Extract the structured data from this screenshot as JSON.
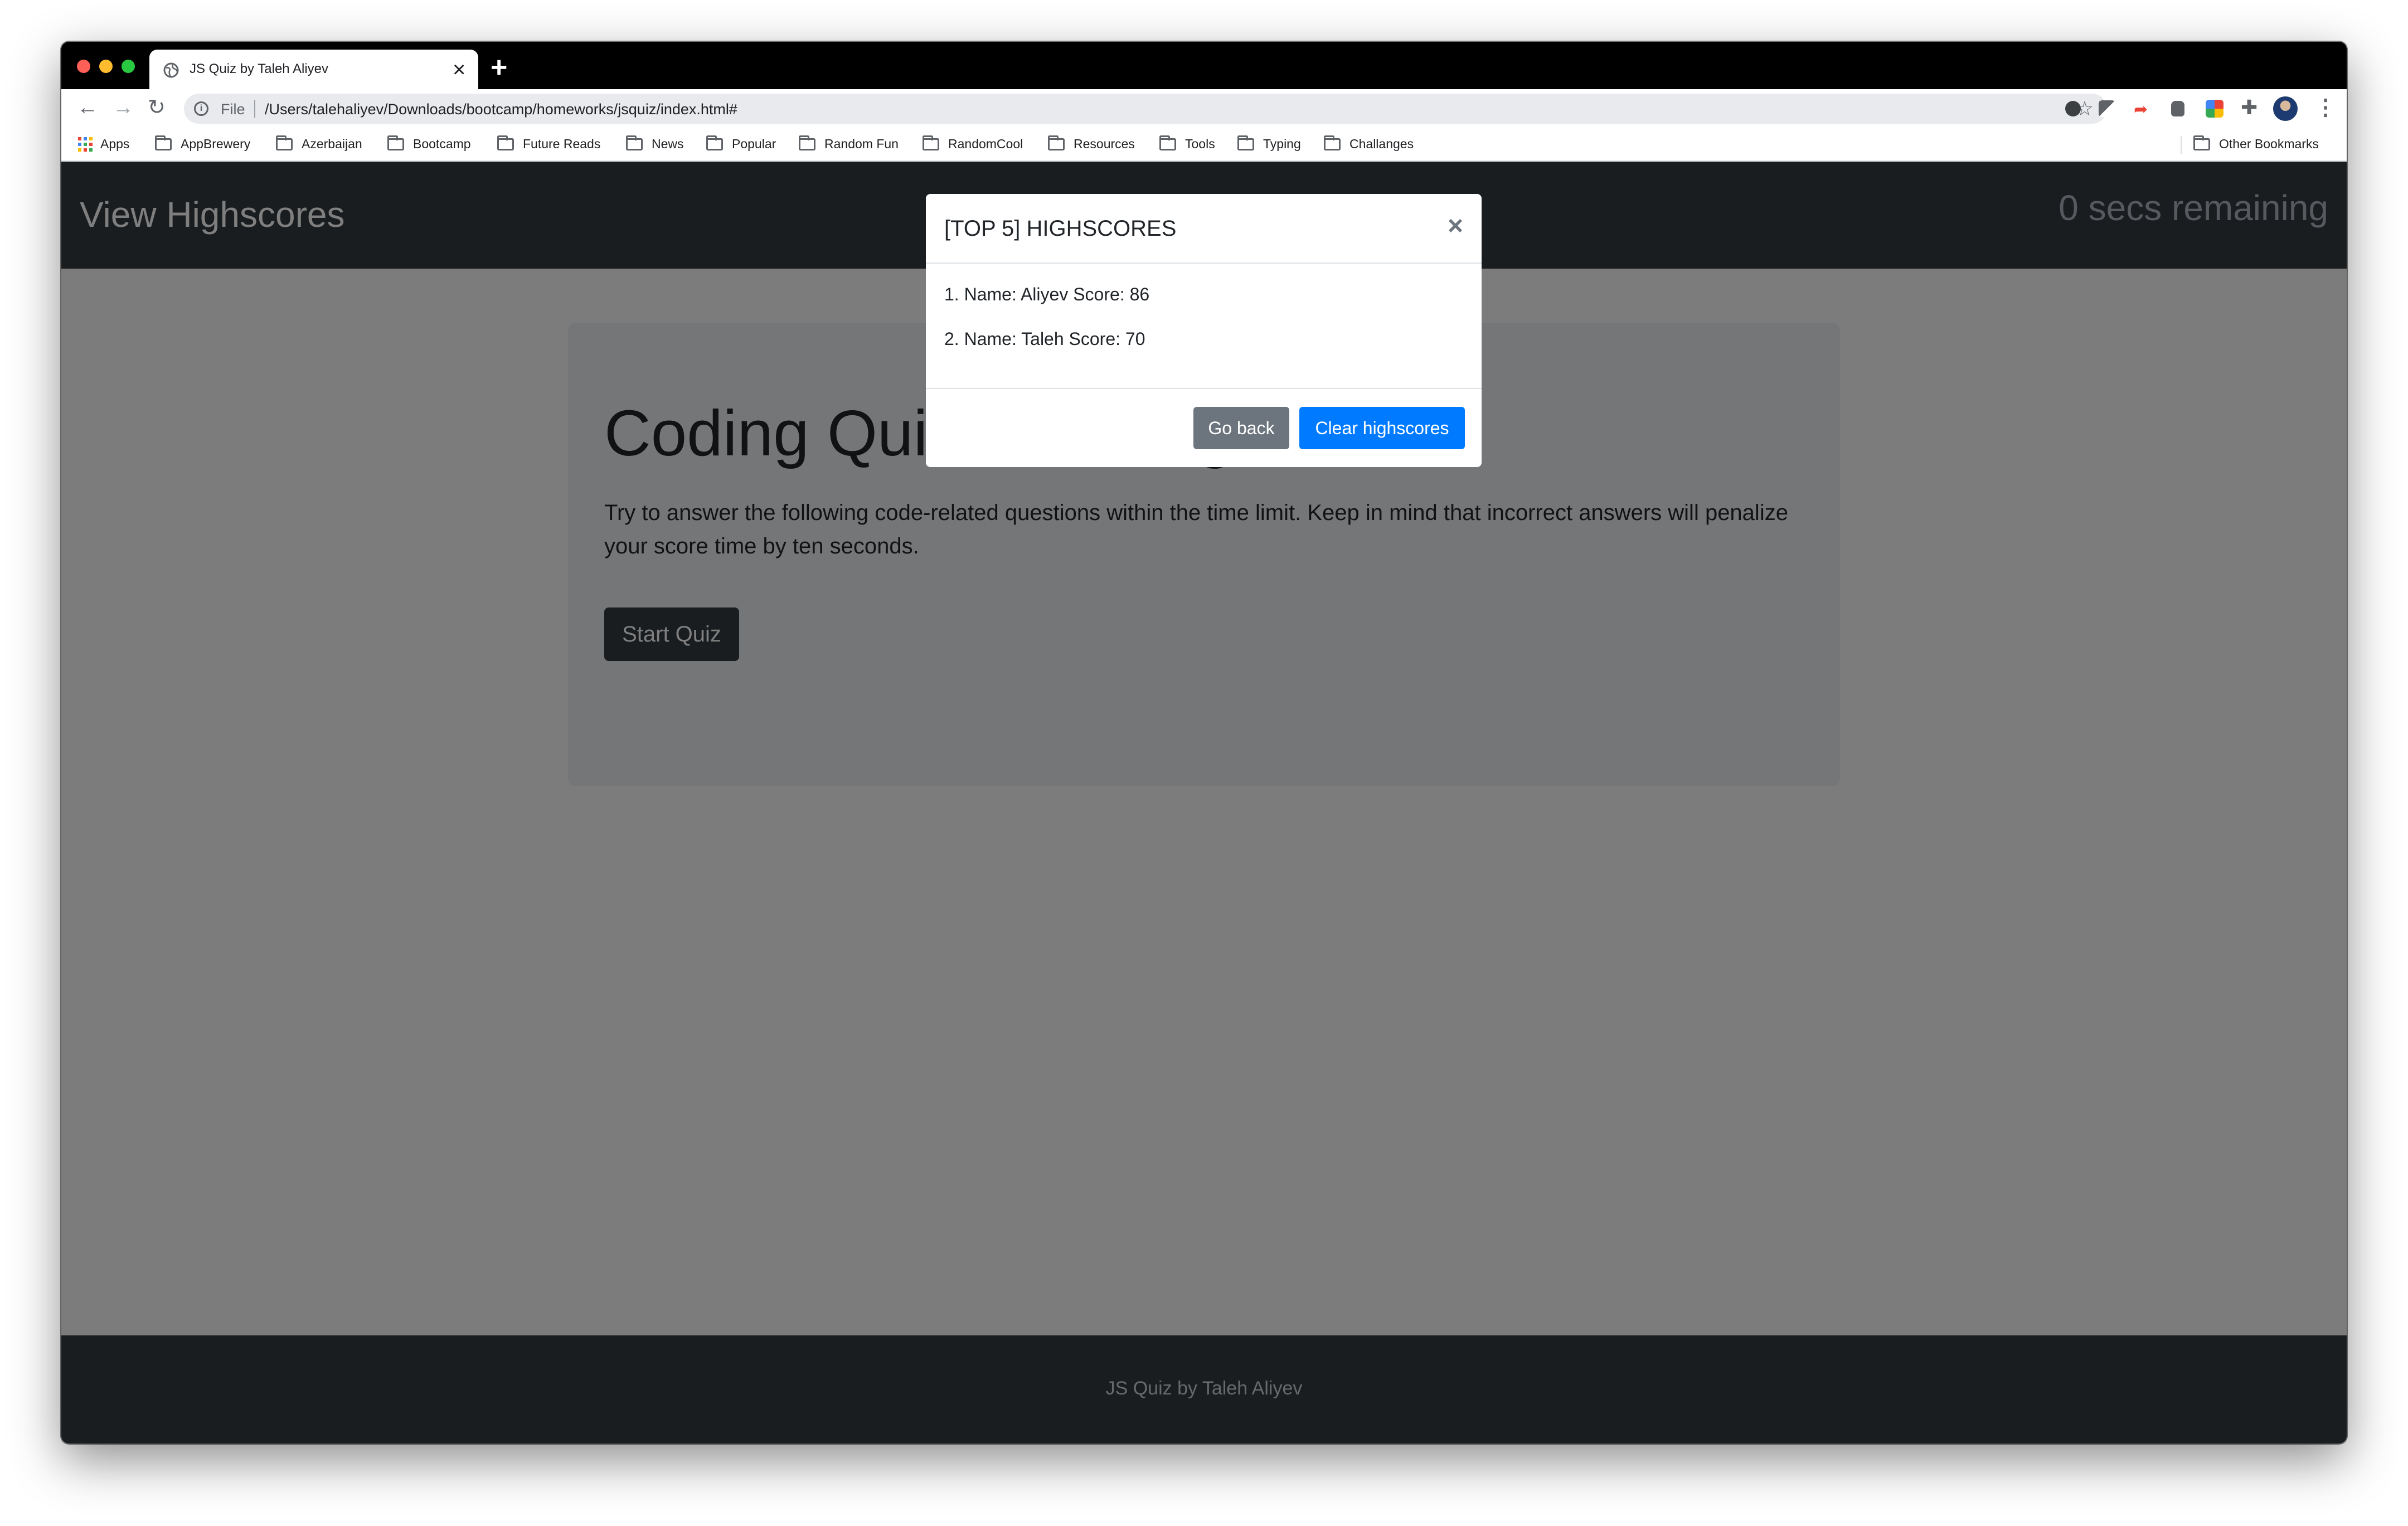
{
  "browser": {
    "tab_title": "JS Quiz by Taleh Aliyev",
    "tab_close": "×",
    "new_tab": "+",
    "nav_back": "←",
    "nav_forward": "→",
    "nav_reload": "↻",
    "omnibox_info": "i",
    "omnibox_scheme": "File",
    "url": "/Users/talehaliyev/Downloads/bootcamp/homeworks/jsquiz/index.html#",
    "star": "☆",
    "puzzle": "✚",
    "menu": "⋮",
    "bookmarks": [
      {
        "label": "Apps",
        "icon": "apps-grid-icon"
      },
      {
        "label": "AppBrewery",
        "icon": "folder-icon"
      },
      {
        "label": "Azerbaijan",
        "icon": "folder-icon"
      },
      {
        "label": "Bootcamp",
        "icon": "folder-icon"
      },
      {
        "label": "Future Reads",
        "icon": "folder-icon"
      },
      {
        "label": "News",
        "icon": "folder-icon"
      },
      {
        "label": "Popular",
        "icon": "folder-icon"
      },
      {
        "label": "Random Fun",
        "icon": "folder-icon"
      },
      {
        "label": "RandomCool",
        "icon": "folder-icon"
      },
      {
        "label": "Resources",
        "icon": "folder-icon"
      },
      {
        "label": "Tools",
        "icon": "folder-icon"
      },
      {
        "label": "Typing",
        "icon": "folder-icon"
      },
      {
        "label": "Challanges",
        "icon": "folder-icon"
      }
    ],
    "other_bookmarks": "Other Bookmarks"
  },
  "page": {
    "header": {
      "view_highscores": "View Highscores",
      "timer": "0 secs remaining"
    },
    "jumbotron": {
      "title": "Coding Quiz Challenge",
      "text": "Try to answer the following code-related questions within the time limit. Keep in mind that incorrect answers will penalize your score time by ten seconds.",
      "start_button": "Start Quiz"
    },
    "footer": {
      "text": "JS Quiz by Taleh Aliyev"
    }
  },
  "modal": {
    "title": "[TOP 5] HIGHSCORES",
    "close": "×",
    "scores": [
      "1. Name: Aliyev Score: 86",
      "2. Name: Taleh Score: 70"
    ],
    "go_back": "Go back",
    "clear": "Clear highscores"
  },
  "colors": {
    "navbar": "#343a40",
    "primary": "#007bff",
    "secondary": "#6c757d"
  }
}
